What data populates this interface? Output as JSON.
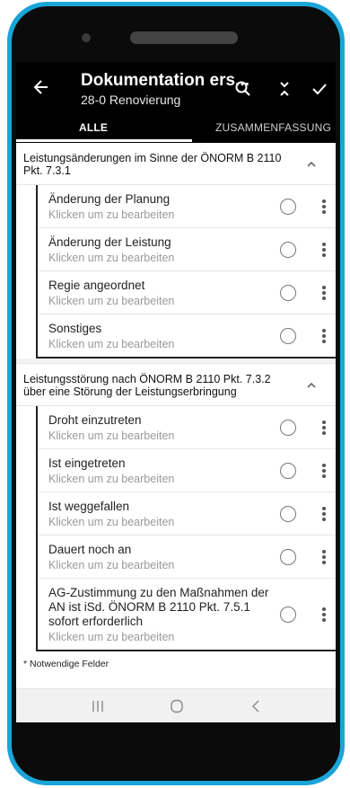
{
  "appbar": {
    "title": "Dokumentation ers...",
    "subtitle": "28-0 Renovierung",
    "icons": [
      "back-arrow-icon",
      "search-icon",
      "collapse-icon",
      "check-icon"
    ]
  },
  "tabs": [
    {
      "label": "ALLE",
      "selected": true
    },
    {
      "label": "ZUSAMMENFASSUNG",
      "selected": false
    }
  ],
  "sections": [
    {
      "title": "Leistungsänderungen im Sinne der ÖNORM B 2110 Pkt. 7.3.1",
      "items": [
        {
          "label": "Änderung der Planung",
          "sub": "Klicken um zu bearbeiten"
        },
        {
          "label": "Änderung der Leistung",
          "sub": "Klicken um zu bearbeiten"
        },
        {
          "label": "Regie angeordnet",
          "sub": "Klicken um zu bearbeiten"
        },
        {
          "label": "Sonstiges",
          "sub": "Klicken um zu bearbeiten"
        }
      ]
    },
    {
      "title": "Leistungsstörung nach ÖNORM B 2110 Pkt. 7.3.2 über eine Störung der Leistungserbringung",
      "items": [
        {
          "label": "Droht einzutreten",
          "sub": "Klicken um zu bearbeiten"
        },
        {
          "label": "Ist eingetreten",
          "sub": "Klicken um zu bearbeiten"
        },
        {
          "label": "Ist weggefallen",
          "sub": "Klicken um zu bearbeiten"
        },
        {
          "label": "Dauert noch an",
          "sub": "Klicken um zu bearbeiten"
        },
        {
          "label": "AG-Zustimmung zu den Maßnahmen der AN ist iSd. ÖNORM B 2110 Pkt. 7.5.1 sofort erforderlich",
          "sub": "Klicken um zu bearbeiten"
        }
      ]
    }
  ],
  "footnote": "* Notwendige Felder",
  "colors": {
    "frame": "#1aa4d8",
    "appbar": "#000000"
  }
}
